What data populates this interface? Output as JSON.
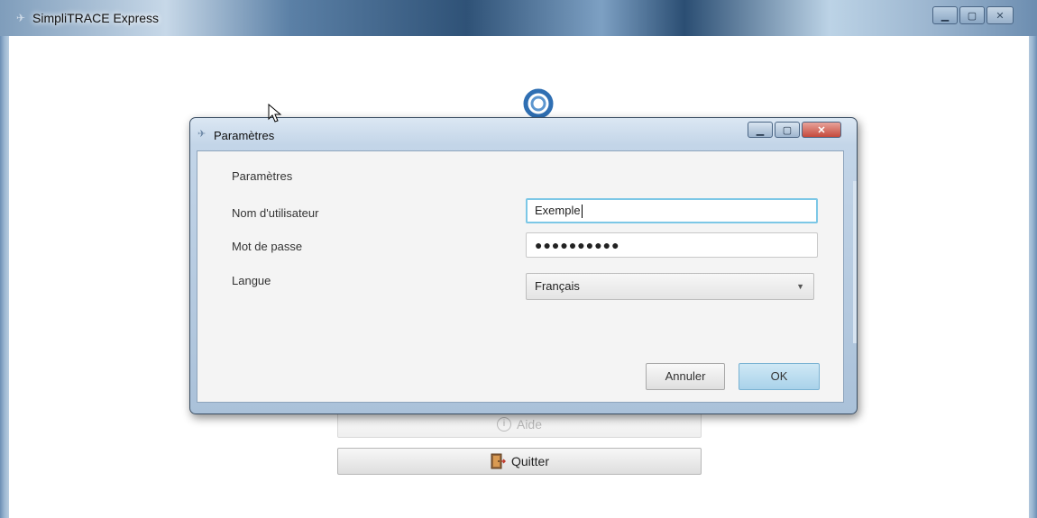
{
  "main_window": {
    "title": "SimpliTRACE Express",
    "help_label": "Aide",
    "quit_label": "Quitter"
  },
  "dialog": {
    "title": "Paramètres",
    "section_title": "Paramètres",
    "username_label": "Nom d'utilisateur",
    "username_value": "Exemple",
    "password_label": "Mot de passe",
    "password_value": "●●●●●●●●●●",
    "language_label": "Langue",
    "language_value": "Français",
    "cancel_label": "Annuler",
    "ok_label": "OK"
  },
  "colors": {
    "accent": "#a9d2ea",
    "focus_border": "#7cc7e6",
    "close_button": "#c44a3c"
  }
}
